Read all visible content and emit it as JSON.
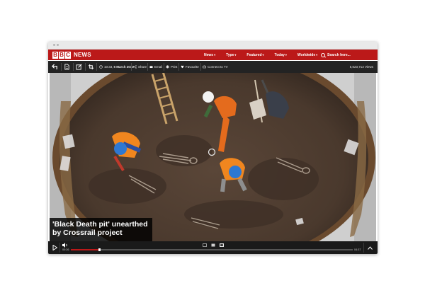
{
  "brand": {
    "letters": [
      "B",
      "B",
      "C"
    ],
    "section": "NEWS"
  },
  "nav": {
    "items": [
      {
        "label": "News",
        "caret": "▾"
      },
      {
        "label": "Type",
        "caret": "▾"
      },
      {
        "label": "Featured",
        "caret": "▾"
      },
      {
        "label": "Today",
        "caret": "▾"
      },
      {
        "label": "Worldwide",
        "caret": "▾"
      }
    ],
    "search_label": "Search here..."
  },
  "toolbar": {
    "time": "10:33,",
    "date": "5 March 2013",
    "share": "Share",
    "email": "Email",
    "print": "Print",
    "favourite": "Favourite",
    "connect": "Connect to TV",
    "views": "5,023,712 Views"
  },
  "video": {
    "caption": "'Black Death pit' unearthed by Crossrail project",
    "time_elapsed": "00:26",
    "time_total": "04:37",
    "progress": 0.1
  },
  "colors": {
    "brand_red": "#bb1919",
    "toolbar": "#232323",
    "controls": "#1a1a1a"
  }
}
